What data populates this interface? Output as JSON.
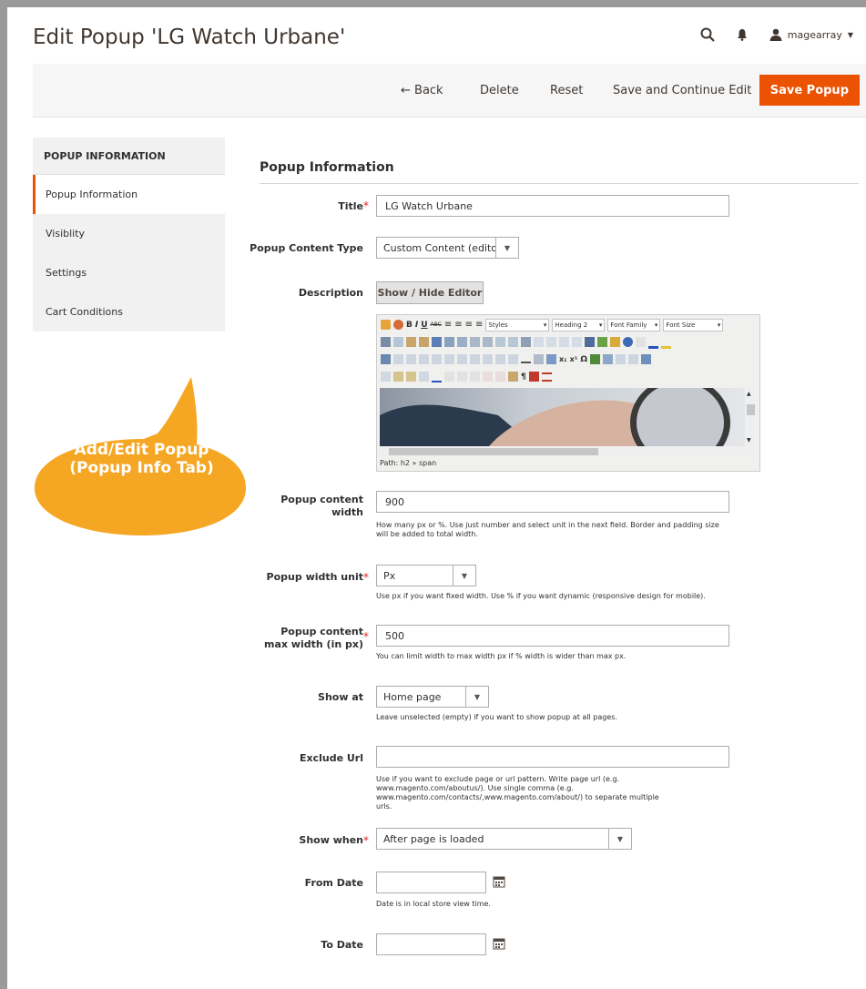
{
  "page": {
    "title": "Edit Popup 'LG Watch Urbane'"
  },
  "header": {
    "user": "magearray",
    "search_icon": "search-icon",
    "bell_icon": "bell-icon",
    "user_icon": "user-icon"
  },
  "actions": {
    "back": "← Back",
    "delete": "Delete",
    "reset": "Reset",
    "save_continue": "Save and Continue Edit",
    "save": "Save Popup"
  },
  "sidebar": {
    "heading": "POPUP INFORMATION",
    "items": [
      {
        "label": "Popup Information",
        "active": true
      },
      {
        "label": "Visiblity"
      },
      {
        "label": "Settings"
      },
      {
        "label": "Cart Conditions"
      }
    ]
  },
  "callout": {
    "line1": "Add/Edit Popup",
    "line2": "(Popup Info Tab)"
  },
  "section": {
    "title": "Popup Information"
  },
  "form": {
    "title": {
      "label": "Title",
      "value": "LG Watch Urbane"
    },
    "content_type": {
      "label": "Popup Content Type",
      "value": "Custom Content (editor)"
    },
    "description": {
      "label": "Description",
      "toggle": "Show / Hide Editor"
    },
    "editor": {
      "styles": "Styles",
      "heading": "Heading 2",
      "font_family": "Font Family",
      "font_size": "Font Size",
      "path": "Path: h2 » span"
    },
    "width": {
      "label": "Popup content width",
      "value": "900",
      "note": "How many px or %. Use just number and select unit in the next field. Border and padding size will be added to total width."
    },
    "unit": {
      "label": "Popup width unit",
      "value": "Px",
      "note": "Use px if you want fixed width. Use % if you want dynamic (responsive design for mobile)."
    },
    "max_width": {
      "label": "Popup content max width (in px)",
      "value": "500",
      "note": "You can limit width to max width px if % width is wider than max px."
    },
    "show_at": {
      "label": "Show at",
      "value": "Home page",
      "note": "Leave unselected (empty) if you want to show popup at all pages."
    },
    "exclude_url": {
      "label": "Exclude Url",
      "value": "",
      "note": "Use if you want to exclude page or url pattern. Write page url (e.g. www.magento.com/aboutus/). Use single comma (e.g. www.magento.com/contacts/,www.magento.com/about/) to separate multiple urls."
    },
    "show_when": {
      "label": "Show when",
      "value": "After page is loaded"
    },
    "from_date": {
      "label": "From Date",
      "value": "",
      "note": "Date is in local store view time."
    },
    "to_date": {
      "label": "To Date",
      "value": ""
    }
  },
  "colors": {
    "accent": "#eb5202",
    "callout": "#f5a623",
    "required": "#e22626"
  }
}
